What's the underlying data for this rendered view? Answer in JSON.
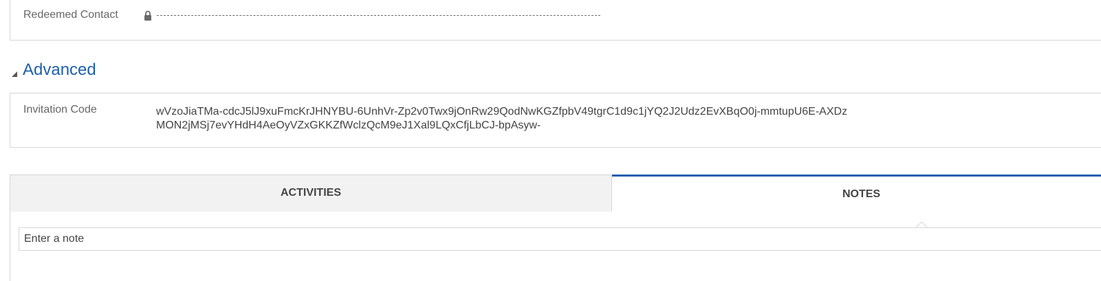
{
  "redeemed_contact": {
    "label": "Redeemed Contact",
    "lock_icon": "lock-icon",
    "value_placeholder": "--------------------------------------------------------------------------------------------------------"
  },
  "advanced": {
    "title": "Advanced",
    "collapse_icon": "triangle-collapse-icon",
    "invitation_code": {
      "label": "Invitation Code",
      "value": "wVzoJiaTMa-cdcJ5lJ9xuFmcKrJHNYBU-6UnhVr-Zp2v0Twx9jOnRw29QodNwKGZfpbV49tgrC1d9c1jYQ2J2Udz2EvXBqO0j-mmtupU6E-AXDzMON2jMSj7evYHdH4AeOyVZxGKKZfWclzQcM9eJ1Xal9LQxCfjLbCJ-bpAsyw-"
    }
  },
  "tabs": [
    {
      "label": "ACTIVITIES",
      "selected": false
    },
    {
      "label": "NOTES",
      "selected": true
    }
  ],
  "notes": {
    "placeholder": "Enter a note"
  },
  "colors": {
    "accent": "#1f5fad",
    "border": "#d6d6d6",
    "tab_inactive_bg": "#f2f2f2"
  }
}
